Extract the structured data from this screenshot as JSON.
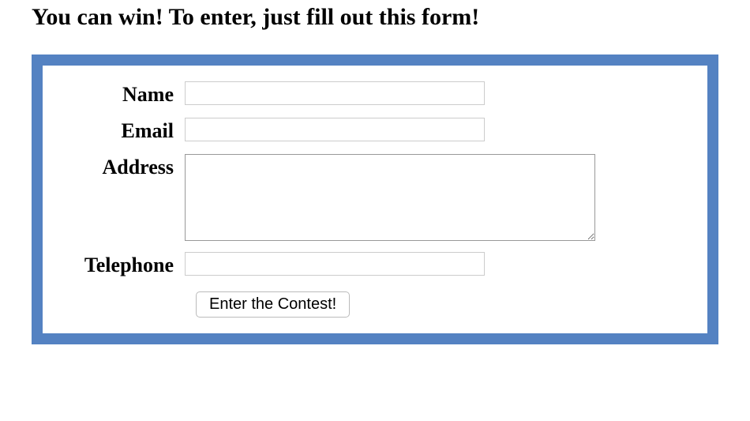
{
  "heading": "You can win! To enter, just fill out this form!",
  "form": {
    "name": {
      "label": "Name",
      "value": ""
    },
    "email": {
      "label": "Email",
      "value": ""
    },
    "address": {
      "label": "Address",
      "value": ""
    },
    "telephone": {
      "label": "Telephone",
      "value": ""
    },
    "submit_label": "Enter the Contest!"
  }
}
